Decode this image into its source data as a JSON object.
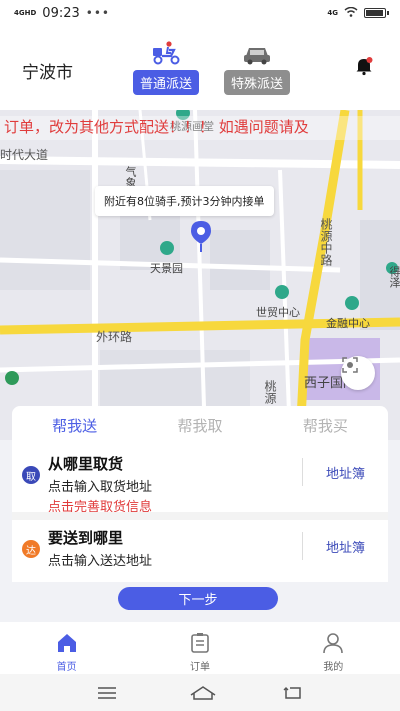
{
  "status_bar": {
    "network": "4GHD",
    "time": "09:23",
    "dots": "•••",
    "right_network": "4G",
    "battery_level": 0.85
  },
  "header": {
    "city": "宁波市",
    "modes": [
      {
        "label": "普通派送",
        "icon": "delivery-rider-icon",
        "active": true
      },
      {
        "label": "特殊派送",
        "icon": "car-icon",
        "active": false
      }
    ],
    "bell_icon": "bell-icon",
    "accent_color": "#4b5de4"
  },
  "map": {
    "marquee": "订单，改为其他方式配送！！！ 如遇问题请及",
    "tooltip": "附近有8位骑手,预计3分钟内接单",
    "roads": [
      "时代大道",
      "外环路",
      "桃源中路",
      "桃源"
    ],
    "places": [
      "桃源画堂",
      "天景园",
      "世贸中心",
      "金融中心",
      "西子国际",
      "得泽",
      "气象"
    ],
    "pin_icon": "location-pin-icon",
    "locate_icon": "locate-icon"
  },
  "order": {
    "tabs": [
      {
        "label": "帮我送",
        "active": true
      },
      {
        "label": "帮我取",
        "active": false
      },
      {
        "label": "帮我买",
        "active": false
      }
    ],
    "pickup": {
      "badge": "取",
      "title": "从哪里取货",
      "subtitle": "点击输入取货地址",
      "warning": "点击完善取货信息",
      "button": "地址簿"
    },
    "drop": {
      "badge": "达",
      "title": "要送到哪里",
      "subtitle": "点击输入送达地址",
      "button": "地址簿"
    },
    "next_button": "下一步"
  },
  "bottom_nav": {
    "items": [
      {
        "label": "首页",
        "icon": "home-icon",
        "active": true
      },
      {
        "label": "订单",
        "icon": "order-list-icon",
        "active": false
      },
      {
        "label": "我的",
        "icon": "user-icon",
        "active": false
      }
    ]
  },
  "system_nav": {
    "icons": [
      "menu-icon",
      "home-outline-icon",
      "back-icon"
    ]
  }
}
